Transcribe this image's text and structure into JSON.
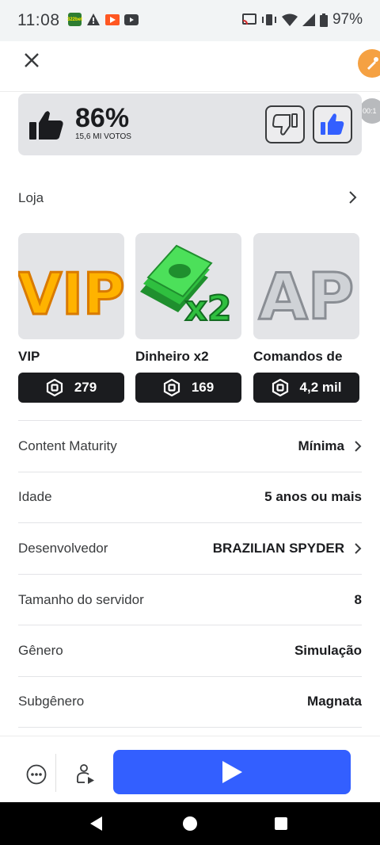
{
  "status_bar": {
    "time": "11:08",
    "badge_322bet": "322bet",
    "battery_percent": "97%"
  },
  "header": {
    "close_icon": "close-icon",
    "brush_icon": "brush-icon",
    "timer_text": "00:1"
  },
  "rating": {
    "percent": "86%",
    "votes": "15,6 MI VOTOS"
  },
  "store": {
    "title": "Loja",
    "items": [
      {
        "name": "VIP",
        "price": "279"
      },
      {
        "name": "Dinheiro x2",
        "price": "169"
      },
      {
        "name": "Comandos de",
        "price": "4,2 mil"
      }
    ],
    "image_labels": [
      "VIP",
      "x2",
      "AP"
    ]
  },
  "info": [
    {
      "label": "Content Maturity",
      "value": "Mínima"
    },
    {
      "label": "Idade",
      "value": "5 anos ou mais"
    },
    {
      "label": "Desenvolvedor",
      "value": "BRAZILIAN SPYDER"
    },
    {
      "label": "Tamanho do servidor",
      "value": "8"
    },
    {
      "label": "Gênero",
      "value": "Simulação"
    },
    {
      "label": "Subgênero",
      "value": "Magnata"
    }
  ],
  "colors": {
    "play_button": "#335fff",
    "vote_up": "#335fff",
    "card_bg": "#e3e4e7",
    "price_bg": "#1b1c1f"
  }
}
